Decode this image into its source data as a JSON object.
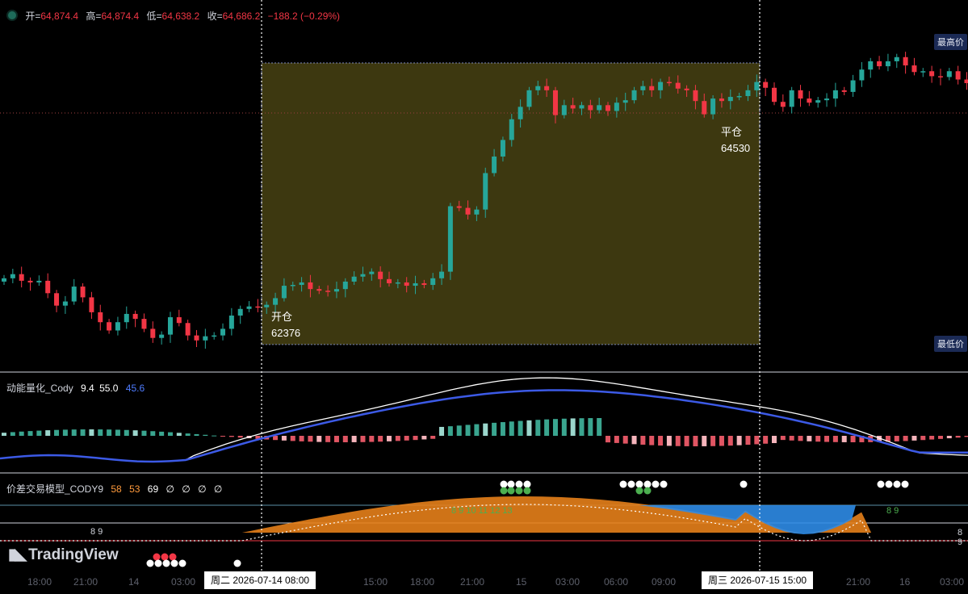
{
  "ohlc_bar": {
    "open_label": "开=",
    "open": "64,874.4",
    "high_label": "高=",
    "high": "64,874.4",
    "low_label": "低=",
    "low": "64,638.2",
    "close_label": "收=",
    "close": "64,686.2",
    "change": "−188.2 (−0.29%)"
  },
  "price_tags": {
    "high": "最高价",
    "low": "最低价"
  },
  "trade": {
    "open_label": "开仓",
    "open_price": "62376",
    "close_label": "平仓",
    "close_price": "64530"
  },
  "indicator1": {
    "name": "动能量化_Cody",
    "v1": "9.4",
    "v2": "55.0",
    "v3": "45.6"
  },
  "indicator2": {
    "name": "价差交易模型_CODY9",
    "v1": "58",
    "v2": "53",
    "v3": "69",
    "null_glyph": "∅"
  },
  "seq_labels": {
    "a": "8 9",
    "b": "8 9 10 11 12 13",
    "c": "8 9",
    "d": "8 9"
  },
  "time_axis": {
    "ticks": [
      "18:00",
      "21:00",
      "14",
      "03:00",
      "15:00",
      "18:00",
      "21:00",
      "15",
      "03:00",
      "06:00",
      "09:00",
      "21:00",
      "16",
      "03:00"
    ],
    "marker_left": "周二  2026-07-14   08:00",
    "marker_right": "周三  2026-07-15   15:00"
  },
  "brand": "TradingView",
  "colors": {
    "up": "#26a69a",
    "down": "#f23645",
    "zone": "#3d3810",
    "ma_blue": "#3c5ae6",
    "area_orange": "#e6801a",
    "area_blue": "#2e8be6"
  },
  "chart_data": {
    "type": "candlestick",
    "ohlc_last": {
      "open": 64874.4,
      "high": 64874.4,
      "low": 64638.2,
      "close": 64686.2
    },
    "trade": {
      "entry": 62376,
      "exit": 64530,
      "entry_time": "2026-07-14 08:00",
      "exit_time": "2026-07-15 15:00"
    },
    "closes": [
      62330,
      62380,
      62300,
      62280,
      62300,
      62150,
      62000,
      62050,
      62230,
      62100,
      61920,
      61800,
      61700,
      61800,
      61900,
      61840,
      61720,
      61610,
      61650,
      61860,
      61790,
      61640,
      61580,
      61630,
      61640,
      61720,
      61880,
      61960,
      61990,
      61980,
      62010,
      62090,
      62240,
      62250,
      62280,
      62200,
      62180,
      62170,
      62200,
      62290,
      62350,
      62380,
      62410,
      62320,
      62270,
      62280,
      62240,
      62270,
      62250,
      62330,
      62410,
      63200,
      63180,
      63100,
      63160,
      63600,
      63800,
      64000,
      64250,
      64400,
      64600,
      64650,
      64600,
      64300,
      64420,
      64380,
      64420,
      64360,
      64420,
      64350,
      64450,
      64480,
      64600,
      64650,
      64600,
      64700,
      64690,
      64620,
      64600,
      64470,
      64310,
      64500,
      64470,
      64520,
      64530,
      64600,
      64700,
      64630,
      64460,
      64400,
      64600,
      64500,
      64450,
      64480,
      64500,
      64600,
      64580,
      64720,
      64850,
      64950,
      64890,
      64950,
      65000,
      64900,
      64820,
      64830,
      64770,
      64760,
      64830,
      64730,
      64686
    ]
  }
}
